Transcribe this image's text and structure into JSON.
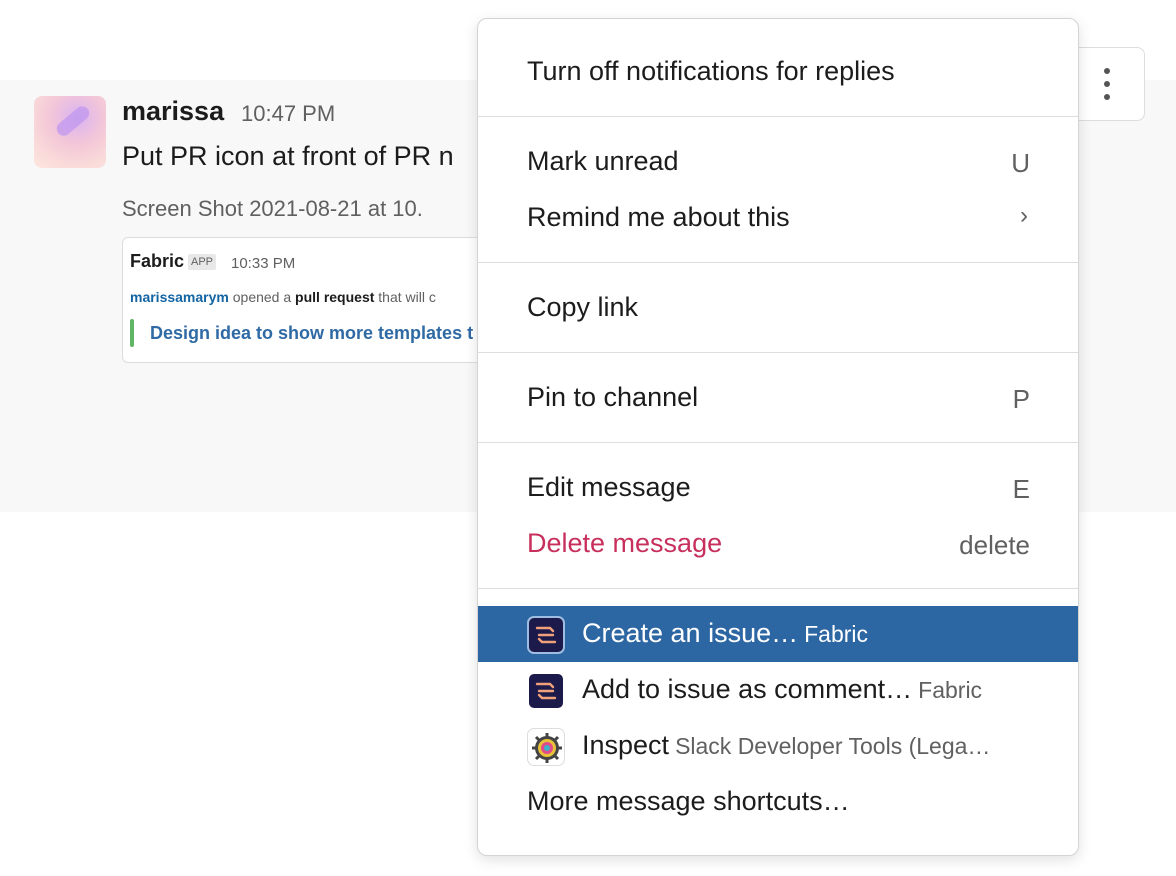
{
  "message": {
    "author": "marissa",
    "time": "10:47 PM",
    "text": "Put PR icon at front of PR n",
    "file_name": "Screen Shot 2021-08-21 at 10.",
    "attachment": {
      "app_name": "Fabric",
      "app_badge": "APP",
      "time": "10:33 PM",
      "user": "marissamarym",
      "action_prefix": "opened a",
      "action_bold": "pull request",
      "action_suffix": "that will c",
      "pr_title": "Design idea to show more templates t"
    }
  },
  "toolbar": {
    "more_icon": "more-actions-icon"
  },
  "menu": {
    "items": [
      {
        "label": "Turn off notifications for replies"
      },
      {
        "label": "Mark unread",
        "shortcut": "U"
      },
      {
        "label": "Remind me about this",
        "chevron": "›"
      },
      {
        "label": "Copy link"
      },
      {
        "label": "Pin to channel",
        "shortcut": "P"
      },
      {
        "label": "Edit message",
        "shortcut": "E"
      },
      {
        "label": "Delete message",
        "shortcut": "delete"
      },
      {
        "label": "Create an issue…",
        "app": "Fabric",
        "icon": "fabric-app-icon"
      },
      {
        "label": "Add to issue as comment…",
        "app": "Fabric",
        "icon": "fabric-app-icon"
      },
      {
        "label": "Inspect",
        "app": "Slack Developer Tools (Lega…",
        "icon": "inspect-app-icon"
      },
      {
        "label": "More message shortcuts…"
      }
    ]
  },
  "colors": {
    "active_bg": "#2d67a3",
    "danger": "#c7305c",
    "link": "#1264a3"
  }
}
